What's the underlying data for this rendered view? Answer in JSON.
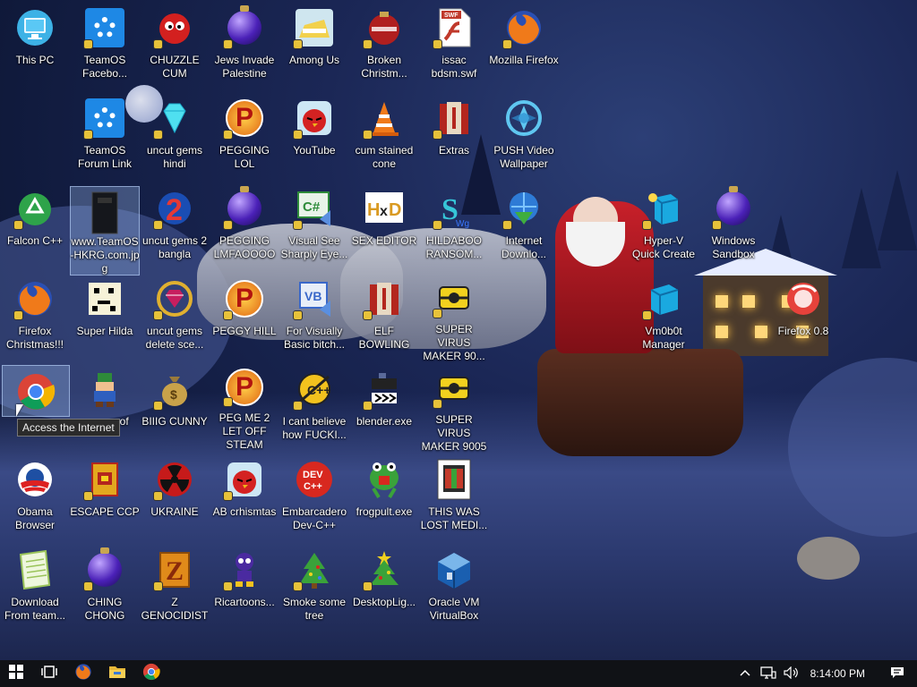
{
  "desktop": {
    "tooltip": "Access the Internet",
    "icons": [
      {
        "label": "This PC",
        "icon": "monitor-icon"
      },
      {
        "label": "TeamOS Facebo...",
        "icon": "gear-icon"
      },
      {
        "label": "CHUZZLE CUM",
        "icon": "chuzzle-icon"
      },
      {
        "label": "Jews Invade Palestine",
        "icon": "ornament-icon"
      },
      {
        "label": "Among Us",
        "icon": "folder-icon"
      },
      {
        "label": "Broken Christm...",
        "icon": "ornament-icon"
      },
      {
        "label": "issac bdsm.swf",
        "icon": "swf-file-icon"
      },
      {
        "label": "Mozilla Firefox",
        "icon": "firefox-icon"
      },
      {
        "label": "TeamOS Forum Link",
        "icon": "gear-icon"
      },
      {
        "label": "uncut gems hindi",
        "icon": "diamond-icon"
      },
      {
        "label": "PEGGING LOL",
        "icon": "p-icon"
      },
      {
        "label": "YouTube",
        "icon": "angry-bird-icon"
      },
      {
        "label": "cum stained cone",
        "icon": "traffic-cone-icon"
      },
      {
        "label": "Extras",
        "icon": "extras-icon"
      },
      {
        "label": "PUSH Video Wallpaper",
        "icon": "push-icon"
      },
      {
        "label": "Falcon C++",
        "icon": "recycle-icon"
      },
      {
        "label": "www.TeamOS-HKRG.com.jpg",
        "icon": "image-file-icon"
      },
      {
        "label": "uncut gems 2 bangla",
        "icon": "number-two-icon"
      },
      {
        "label": "PEGGING LMFAOOOO",
        "icon": "ornament-icon"
      },
      {
        "label": "Visual See Sharply Eye...",
        "icon": "csharp-icon"
      },
      {
        "label": "SEX EDITOR",
        "icon": "hxd-icon"
      },
      {
        "label": "HILDABOO RANSOM...",
        "icon": "ransom-icon"
      },
      {
        "label": "Internet Downlo...",
        "icon": "globe-download-icon"
      },
      {
        "label": "Hyper-V Quick Create",
        "icon": "hyperv-icon"
      },
      {
        "label": "Windows Sandbox",
        "icon": "ornament-icon"
      },
      {
        "label": "Firefox Christmas!!!",
        "icon": "firefox-icon"
      },
      {
        "label": "Super Hilda",
        "icon": "pixel-cat-icon"
      },
      {
        "label": "uncut gems delete sce...",
        "icon": "gem-icon"
      },
      {
        "label": "PEGGY HILL",
        "icon": "p-icon"
      },
      {
        "label": "For Visually Basic bitch...",
        "icon": "vb-icon"
      },
      {
        "label": "ELF BOWLING",
        "icon": "extras-icon"
      },
      {
        "label": "SUPER VIRUS MAKER 90...",
        "icon": "virus-icon"
      },
      {
        "label": "Vm0b0t Manager",
        "icon": "hyperv-icon"
      },
      {
        "label": "Firefox 0.8",
        "icon": "firefox-old-icon"
      },
      {
        "label": "",
        "icon": "chrome-icon"
      },
      {
        "label": "... of",
        "icon": "pixel-hero-icon"
      },
      {
        "label": "BIIIG CUNNY",
        "icon": "money-bag-icon"
      },
      {
        "label": "PEG ME 2 LET OFF STEAM",
        "icon": "p-icon"
      },
      {
        "label": "I cant believe how FUCKI...",
        "icon": "cpp-icon"
      },
      {
        "label": "blender.exe",
        "icon": "blender-icon"
      },
      {
        "label": "SUPER VIRUS MAKER 9005",
        "icon": "virus-icon"
      },
      {
        "label": "Obama Browser",
        "icon": "obama-icon"
      },
      {
        "label": "ESCAPE CCP",
        "icon": "book-icon"
      },
      {
        "label": "UKRAINE",
        "icon": "radiation-icon"
      },
      {
        "label": "AB crhismtas",
        "icon": "angry-bird-icon"
      },
      {
        "label": "Embarcadero Dev-C++",
        "icon": "devcpp-icon"
      },
      {
        "label": "frogpult.exe",
        "icon": "frog-icon"
      },
      {
        "label": "THIS WAS LOST MEDI...",
        "icon": "lost-media-icon"
      },
      {
        "label": "Download From team...",
        "icon": "notepad-icon"
      },
      {
        "label": "CHING CHONG",
        "icon": "ornament-icon"
      },
      {
        "label": "Z GENOCIDIST",
        "icon": "z-icon"
      },
      {
        "label": "Ricartoons...",
        "icon": "cartoon-icon"
      },
      {
        "label": "Smoke some tree",
        "icon": "xmas-tree-icon"
      },
      {
        "label": "DesktopLig...",
        "icon": "xmas-tree-icon"
      },
      {
        "label": "Oracle VM VirtualBox",
        "icon": "virtualbox-icon"
      }
    ]
  },
  "taskbar": {
    "clock": "8:14:00 PM",
    "pinned": [
      "start-icon",
      "task-view-icon",
      "firefox-icon",
      "file-explorer-icon",
      "chrome-icon"
    ],
    "tray": [
      "chevron-up-icon",
      "network-icon",
      "volume-icon"
    ]
  }
}
